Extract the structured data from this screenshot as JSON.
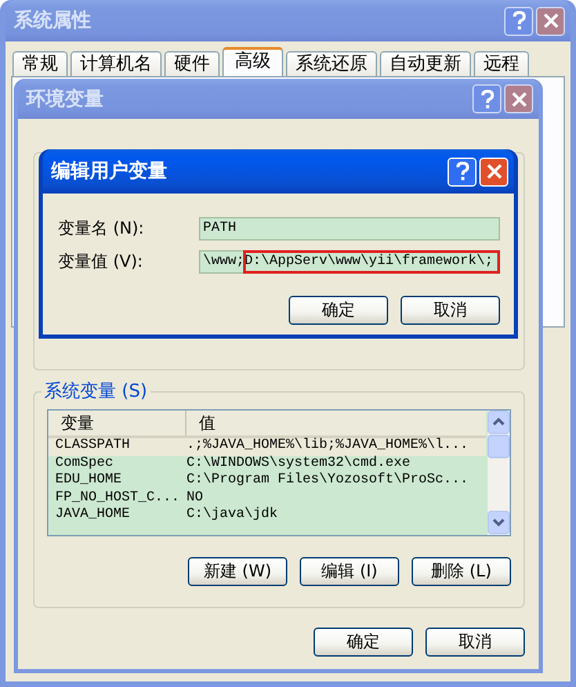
{
  "window": {
    "title": "系统属性",
    "active": false
  },
  "tabs": [
    {
      "label": "常规",
      "selected": false
    },
    {
      "label": "计算机名",
      "selected": false
    },
    {
      "label": "硬件",
      "selected": false
    },
    {
      "label": "高级",
      "selected": true
    },
    {
      "label": "系统还原",
      "selected": false
    },
    {
      "label": "自动更新",
      "selected": false
    },
    {
      "label": "远程",
      "selected": false
    }
  ],
  "env_dialog": {
    "title": "环境变量",
    "active": false,
    "system_variables": {
      "label": "系统变量 (S)",
      "columns": [
        "变量",
        "值"
      ],
      "rows": [
        {
          "name": "CLASSPATH",
          "value": ".;%JAVA_HOME%\\lib;%JAVA_HOME%\\l...",
          "selected": true
        },
        {
          "name": "ComSpec",
          "value": "C:\\WINDOWS\\system32\\cmd.exe",
          "selected": false
        },
        {
          "name": "EDU_HOME",
          "value": "C:\\Program Files\\Yozosoft\\ProSc...",
          "selected": false
        },
        {
          "name": "FP_NO_HOST_C...",
          "value": "NO",
          "selected": false
        },
        {
          "name": "JAVA_HOME",
          "value": "C:\\java\\jdk",
          "selected": false
        }
      ],
      "buttons": [
        "新建 (W)",
        "编辑 (I)",
        "删除 (L)"
      ]
    },
    "buttons": [
      "确定",
      "取消"
    ]
  },
  "edit_dialog": {
    "title": "编辑用户变量",
    "active": true,
    "fields": [
      {
        "label": "变量名 (N):",
        "value": "PATH",
        "highlighted": false
      },
      {
        "label": "变量值 (V):",
        "value": "\\www;D:\\AppServ\\www\\yii\\framework\\;",
        "highlighted": true
      }
    ],
    "buttons": [
      "确定",
      "取消"
    ]
  }
}
